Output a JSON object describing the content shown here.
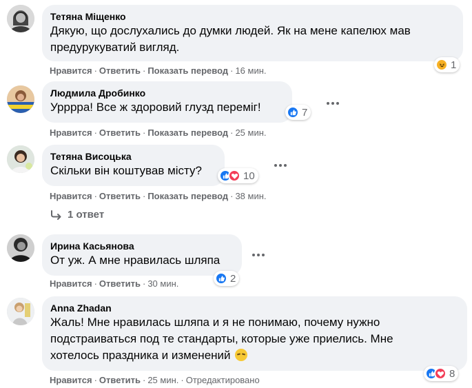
{
  "labels": {
    "like": "Нравится",
    "reply": "Ответить",
    "translate": "Показать перевод",
    "separator": "·"
  },
  "comments": [
    {
      "author": "Тетяна Міщенко",
      "lines": [
        "Дякую, що дослухались до думки людей. Як на мене капелюх мав",
        "предурукуватий вигляд."
      ],
      "time": "16 мин.",
      "reactions": [
        "haha"
      ],
      "reaction_count": "1"
    },
    {
      "author": "Людмила Дробинко",
      "lines": [
        "Урррра! Все ж здоровий глузд переміг!"
      ],
      "time": "25 мин.",
      "reactions": [
        "like"
      ],
      "reaction_count": "7"
    },
    {
      "author": "Тетяна Висоцька",
      "lines": [
        "Скільки він коштував місту?"
      ],
      "time": "38 мин.",
      "reactions": [
        "like",
        "love"
      ],
      "reaction_count": "10",
      "replies_label": "1 ответ"
    },
    {
      "author": "Ирина Касьянова",
      "lines": [
        "От уж. А мне нравилась шляпа"
      ],
      "time": "30 мин.",
      "reactions": [
        "like"
      ],
      "reaction_count": "2"
    },
    {
      "author": "Anna Zhadan",
      "lines": [
        "Жаль! Мне нравилась шляпа и я не понимаю, почему нужно",
        "подстраиваться под те стандарты, которые уже приелись. Мне",
        "хотелось праздника и изменений"
      ],
      "inline_emoji": "pensive-face-emoji",
      "time": "25 мин.",
      "edited": "Отредактировано",
      "reactions": [
        "like",
        "love"
      ],
      "reaction_count": "8"
    }
  ],
  "colors": {
    "bubble": "#f0f2f5",
    "meta_text": "#65676b",
    "like_blue": "#1877f2",
    "love_red": "#f33e58",
    "haha_yellow": "#f7b125"
  }
}
